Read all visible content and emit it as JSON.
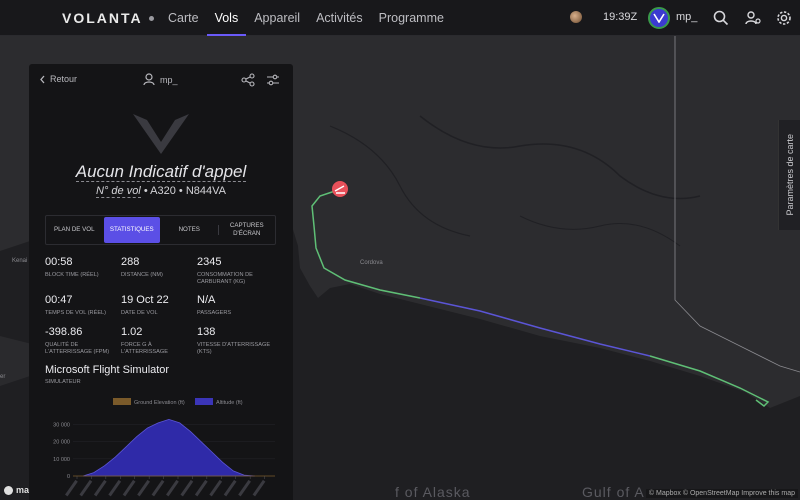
{
  "brand": {
    "name": "VOLANTA"
  },
  "nav": {
    "items": [
      "Carte",
      "Vols",
      "Appareil",
      "Activités",
      "Programme"
    ],
    "active_index": 1
  },
  "header": {
    "clock": "19:39Z",
    "user": "mp_"
  },
  "colors": {
    "accent": "#5b4fe6",
    "route_green": "#5fbf76",
    "route_blue": "#5b55d6"
  },
  "panel": {
    "back_label": "Retour",
    "user": "mp_",
    "callsign": "Aucun Indicatif d'appel",
    "flight_number": "N° de vol",
    "aircraft": "A320",
    "registration": "N844VA",
    "separator": "•",
    "tabs": [
      "PLAN DE VOL",
      "STATISTIQUES",
      "NOTES",
      "CAPTURES D'ÉCRAN"
    ],
    "active_tab": 1,
    "stats": [
      {
        "value": "00:58",
        "label": "BLOCK TIME (RÉEL)"
      },
      {
        "value": "288",
        "label": "DISTANCE (NM)"
      },
      {
        "value": "2345",
        "label": "CONSOMMATION DE CARBURANT (KG)"
      },
      {
        "value": "00:47",
        "label": "TEMPS DE VOL (RÉEL)"
      },
      {
        "value": "19 Oct 22",
        "label": "DATE DE VOL"
      },
      {
        "value": "N/A",
        "label": "PASSAGERS"
      },
      {
        "value": "-398.86",
        "label": "QUALITÉ DE L'ATTERRISSAGE (FPM)"
      },
      {
        "value": "1.02",
        "label": "FORCE G À L'ATTERRISSAGE"
      },
      {
        "value": "138",
        "label": "VITESSE D'ATTERRISSAGE (KTS)"
      }
    ],
    "simulator": "Microsoft Flight Simulator",
    "simulator_label": "SIMULATEUR"
  },
  "map": {
    "labels": {
      "kenai": "Kenai",
      "cordova": "Cordova",
      "gulf1": "f of Alaska",
      "gulf2": "Gulf of A",
      "edge": "er"
    },
    "settings_tab": "Paramètres de carte",
    "attribution": "© Mapbox © OpenStreetMap  Improve this map",
    "logo": "mapbox"
  },
  "chart_data": {
    "type": "area",
    "series": [
      {
        "name": "Ground Elevation (ft)",
        "values": [
          0,
          0,
          0,
          0,
          0,
          0,
          0,
          0,
          0,
          0,
          0,
          0,
          0,
          0,
          0,
          0,
          0
        ]
      },
      {
        "name": "Altitude (ft)",
        "values": [
          0,
          2000,
          6000,
          11000,
          17000,
          23000,
          28000,
          31000,
          33000,
          31000,
          26000,
          20000,
          14000,
          8000,
          3000,
          500,
          0
        ]
      }
    ],
    "y_ticks": [
      "30 000",
      "20 000",
      "10 000",
      "0"
    ],
    "ylim": [
      0,
      35000
    ],
    "legend_position": "top",
    "x_tick_count": 14
  }
}
